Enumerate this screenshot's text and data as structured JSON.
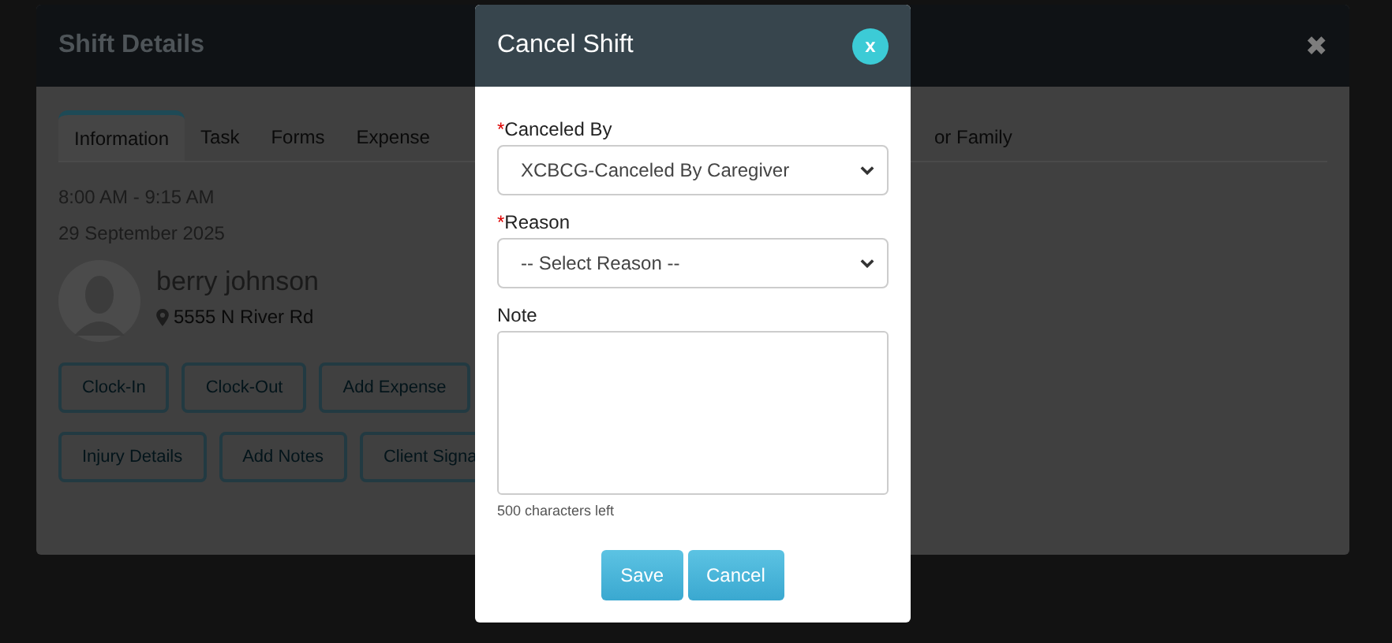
{
  "shift_details": {
    "title": "Shift Details",
    "close": "✖",
    "tabs": [
      {
        "label": "Information",
        "selected": true
      },
      {
        "label": "Task",
        "selected": false
      },
      {
        "label": "Forms",
        "selected": false
      },
      {
        "label": "Expense",
        "selected": false
      }
    ],
    "hidden_tab": {
      "label": "or Family"
    },
    "time": "8:00 AM - 9:15 AM",
    "date": "29 September 2025",
    "client": {
      "name": "berry johnson",
      "address": "5555 N River Rd"
    },
    "button_rows": [
      [
        "Clock-In",
        "Clock-Out",
        "Add Expense"
      ],
      [
        "Injury Details",
        "Add Notes",
        "Client Signa"
      ]
    ]
  },
  "cancel_shift": {
    "title": "Cancel Shift",
    "close": "x",
    "fields": [
      {
        "kind": "select",
        "label": "Canceled By",
        "required_mark": "*",
        "value": "XCBCG-Canceled By Caregiver"
      },
      {
        "kind": "select",
        "label": "Reason",
        "required_mark": "*",
        "value": "-- Select Reason --"
      },
      {
        "kind": "textarea",
        "label": "Note",
        "hint": "500 characters left"
      }
    ],
    "buttons": [
      "Save",
      "Cancel"
    ]
  }
}
